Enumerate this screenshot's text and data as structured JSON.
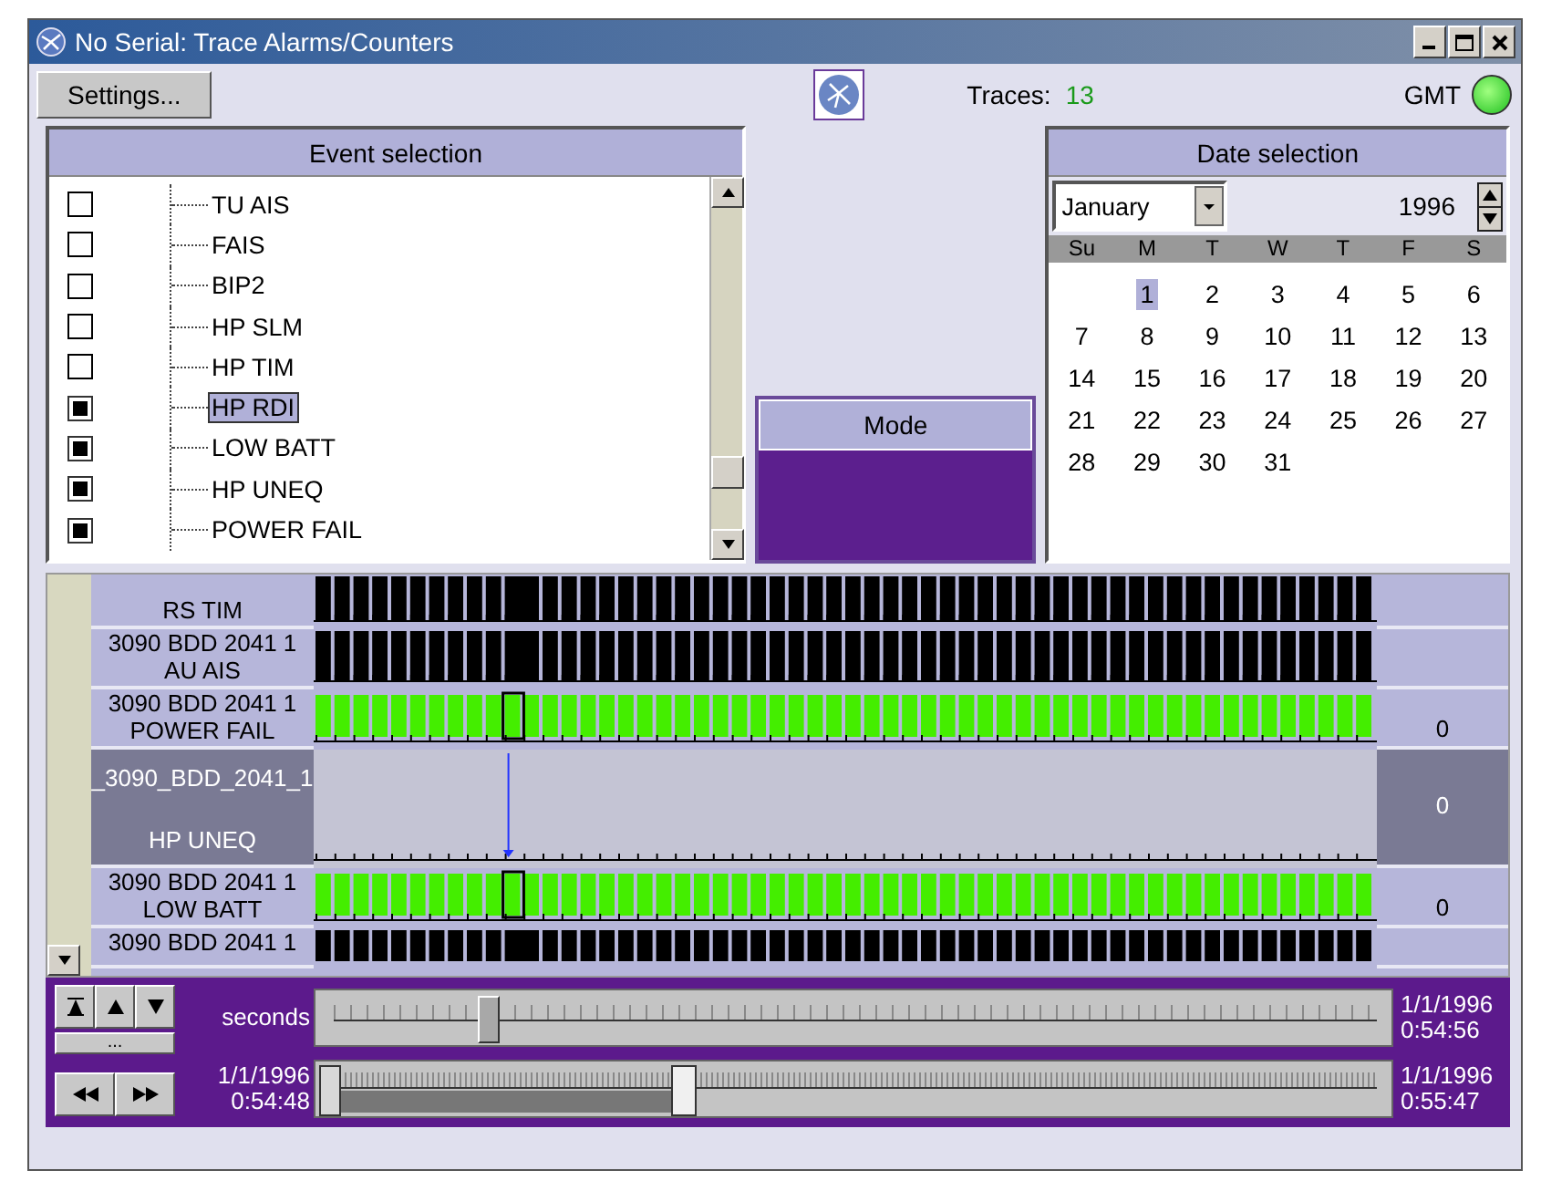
{
  "window": {
    "title": "No Serial: Trace Alarms/Counters"
  },
  "toolbar": {
    "settings_button": "Settings...",
    "traces_label": "Traces:",
    "traces_count": "13",
    "gmt_label": "GMT",
    "gmt_on": true
  },
  "event_selection": {
    "title": "Event selection",
    "items": [
      {
        "label": "TU AIS",
        "checked": false,
        "selected": false
      },
      {
        "label": "FAIS",
        "checked": false,
        "selected": false
      },
      {
        "label": "BIP2",
        "checked": false,
        "selected": false
      },
      {
        "label": "HP SLM",
        "checked": false,
        "selected": false
      },
      {
        "label": "HP TIM",
        "checked": false,
        "selected": false
      },
      {
        "label": "HP RDI",
        "checked": true,
        "selected": true
      },
      {
        "label": "LOW BATT",
        "checked": true,
        "selected": false
      },
      {
        "label": "HP UNEQ",
        "checked": true,
        "selected": false
      },
      {
        "label": "POWER FAIL",
        "checked": true,
        "selected": false
      }
    ]
  },
  "mode": {
    "title": "Mode"
  },
  "date_selection": {
    "title": "Date selection",
    "month": "January",
    "year": "1996",
    "weekdays": [
      "Su",
      "M",
      "T",
      "W",
      "T",
      "F",
      "S"
    ],
    "weeks": [
      [
        {
          "day": "1",
          "selected": true
        },
        {
          "day": "2",
          "selected": false
        },
        {
          "day": "3",
          "selected": false
        },
        {
          "day": "4",
          "selected": false
        },
        {
          "day": "5",
          "selected": false
        },
        {
          "day": "6",
          "selected": false
        }
      ],
      [
        {
          "day": "7",
          "selected": false
        },
        {
          "day": "8",
          "selected": false
        },
        {
          "day": "9",
          "selected": false
        },
        {
          "day": "10",
          "selected": false
        },
        {
          "day": "11",
          "selected": false
        },
        {
          "day": "12",
          "selected": false
        },
        {
          "day": "13",
          "selected": false
        }
      ],
      [
        {
          "day": "14",
          "selected": false
        },
        {
          "day": "15",
          "selected": false
        },
        {
          "day": "16",
          "selected": false
        },
        {
          "day": "17",
          "selected": false
        },
        {
          "day": "18",
          "selected": false
        },
        {
          "day": "19",
          "selected": false
        },
        {
          "day": "20",
          "selected": false
        }
      ],
      [
        {
          "day": "21",
          "selected": false
        },
        {
          "day": "22",
          "selected": false
        },
        {
          "day": "23",
          "selected": false
        },
        {
          "day": "24",
          "selected": false
        },
        {
          "day": "25",
          "selected": false
        },
        {
          "day": "26",
          "selected": false
        },
        {
          "day": "27",
          "selected": false
        }
      ],
      [
        {
          "day": "28",
          "selected": false
        },
        {
          "day": "29",
          "selected": false
        },
        {
          "day": "30",
          "selected": false
        },
        {
          "day": "31",
          "selected": false
        }
      ]
    ]
  },
  "traces": [
    {
      "name": "RS TIM",
      "kind": "black",
      "selected": false
    },
    {
      "id": "3090  BDD  2041  1",
      "name": "AU AIS",
      "kind": "black",
      "selected": false
    },
    {
      "id": "3090  BDD  2041  1",
      "name": "POWER FAIL",
      "kind": "green",
      "count": "0",
      "selected": false
    },
    {
      "id": "_3090_BDD_2041_1",
      "name": "HP UNEQ",
      "kind": "empty",
      "count": "0",
      "selected": true
    },
    {
      "id": "3090  BDD  2041  1",
      "name": "LOW BATT",
      "kind": "green",
      "count": "0",
      "selected": false
    },
    {
      "id": "3090  BDD  2041  1",
      "kind": "black",
      "selected": false
    }
  ],
  "navigation": {
    "more_button": "...",
    "seconds_label": "seconds",
    "seconds_slider": {
      "level": 0.15,
      "end_date": "1/1/1996",
      "end_time": "0:54:56"
    },
    "range_slider": {
      "level": 0.33,
      "start_date": "1/1/1996",
      "start_time": "0:54:48",
      "end_date": "1/1/1996",
      "end_time": "0:55:47"
    }
  }
}
